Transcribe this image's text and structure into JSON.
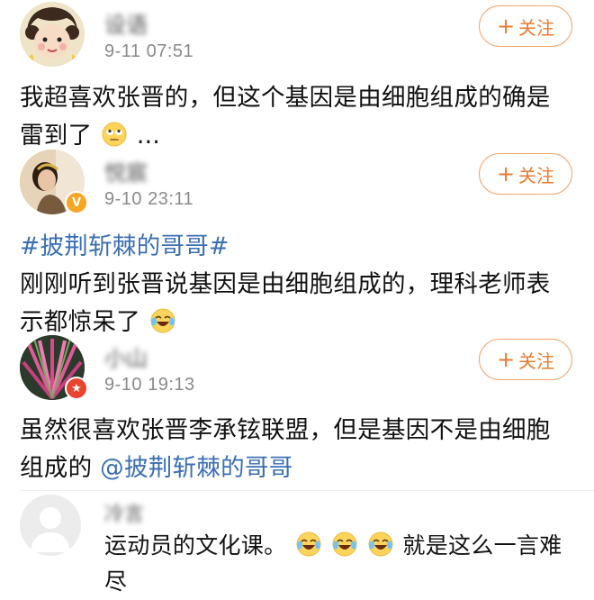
{
  "posts": [
    {
      "username": "设语",
      "timestamp": "9-11 07:51",
      "follow_label": "关注",
      "content": "我超喜欢张晋的，但这个基因是由细胞组成的确是雷到了",
      "content_suffix": "..."
    },
    {
      "username": "悦宸",
      "timestamp": "9-10 23:11",
      "follow_label": "关注",
      "topic": "#披荆斩棘的哥哥#",
      "content": "刚刚听到张晋说基因是由细胞组成的，理科老师表示都惊呆了"
    },
    {
      "username": "小山",
      "timestamp": "9-10 19:13",
      "follow_label": "关注",
      "content": "虽然很喜欢张晋李承铉联盟，但是基因不是由细胞组成的",
      "mention": "@披荆斩棘的哥哥"
    }
  ],
  "reply": {
    "username": "冷言",
    "content_a": "运动员的文化课。",
    "content_b": "就是这么一言难尽"
  },
  "colors": {
    "follow": "#ea7a2f",
    "link": "#3a6fb5",
    "timestamp": "#8a8a8a"
  },
  "icons": [
    "plus-icon",
    "rolling-eyes-emoji",
    "laughing-tears-emoji",
    "verified-badge-icon"
  ]
}
